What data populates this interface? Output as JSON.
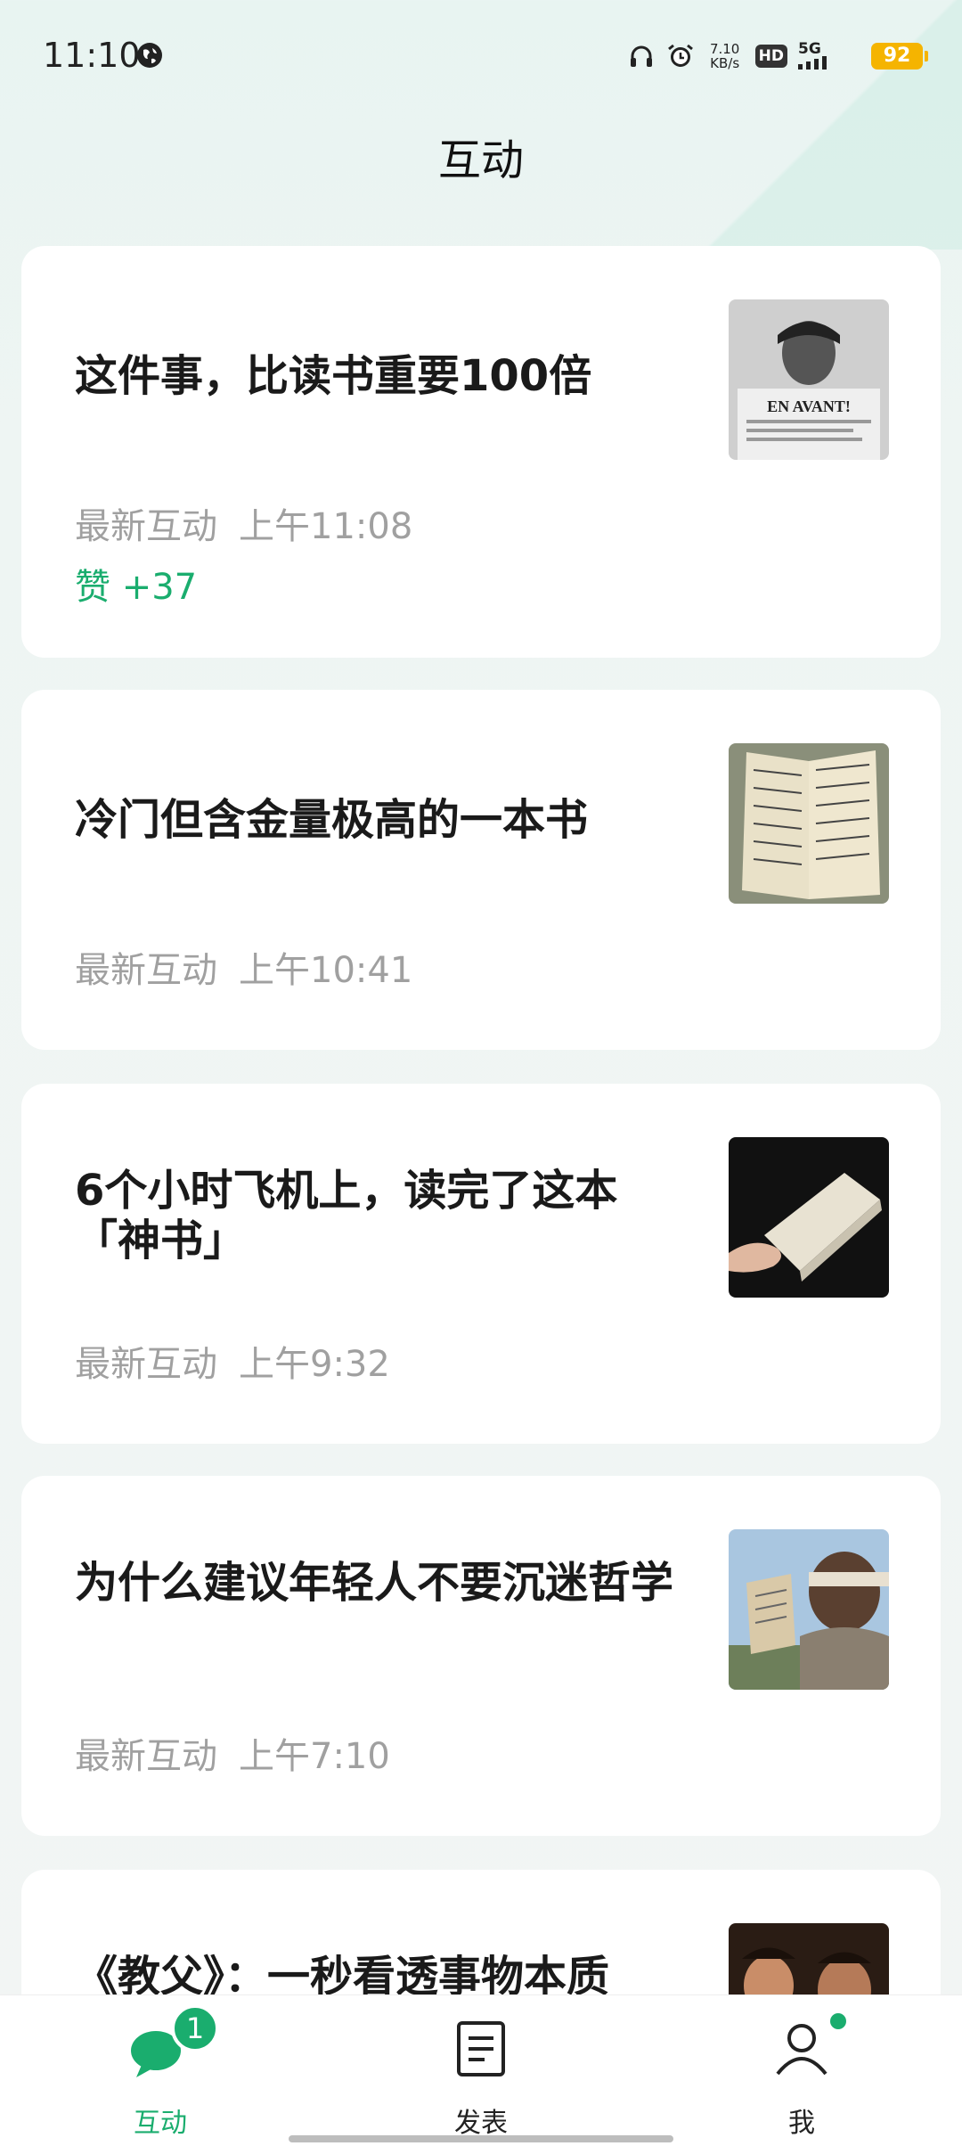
{
  "status_bar": {
    "time": "11:10",
    "net_speed_value": "7.10",
    "net_speed_unit": "KB/s",
    "hd_label": "HD",
    "signal_label": "5G",
    "battery": "92",
    "icons": [
      "globe-icon",
      "headphones-icon",
      "alarm-icon"
    ]
  },
  "header": {
    "title": "互动"
  },
  "cards": [
    {
      "title": "这件事，比读书重要100倍",
      "time_label": "最新互动",
      "time_value": "上午11:08",
      "like": "赞 +37",
      "thumb_text": "EN AVANT!"
    },
    {
      "title": "冷门但含金量极高的一本书",
      "time_label": "最新互动",
      "time_value": "上午10:41"
    },
    {
      "title": "6个小时飞机上，读完了这本「神书」",
      "time_label": "最新互动",
      "time_value": "上午9:32"
    },
    {
      "title": "为什么建议年轻人不要沉迷哲学",
      "time_label": "最新互动",
      "time_value": "上午7:10"
    },
    {
      "title": "《教父》：一秒看透事物本质"
    }
  ],
  "bottom_nav": {
    "items": [
      {
        "label": "互动",
        "icon": "chat-bubble-icon",
        "badge": "1",
        "active": true
      },
      {
        "label": "发表",
        "icon": "document-icon"
      },
      {
        "label": "我",
        "icon": "person-icon",
        "dot": true
      }
    ]
  },
  "colors": {
    "accent": "#1aad6e",
    "battery": "#f5b400",
    "muted_text": "#a0a0a0"
  }
}
